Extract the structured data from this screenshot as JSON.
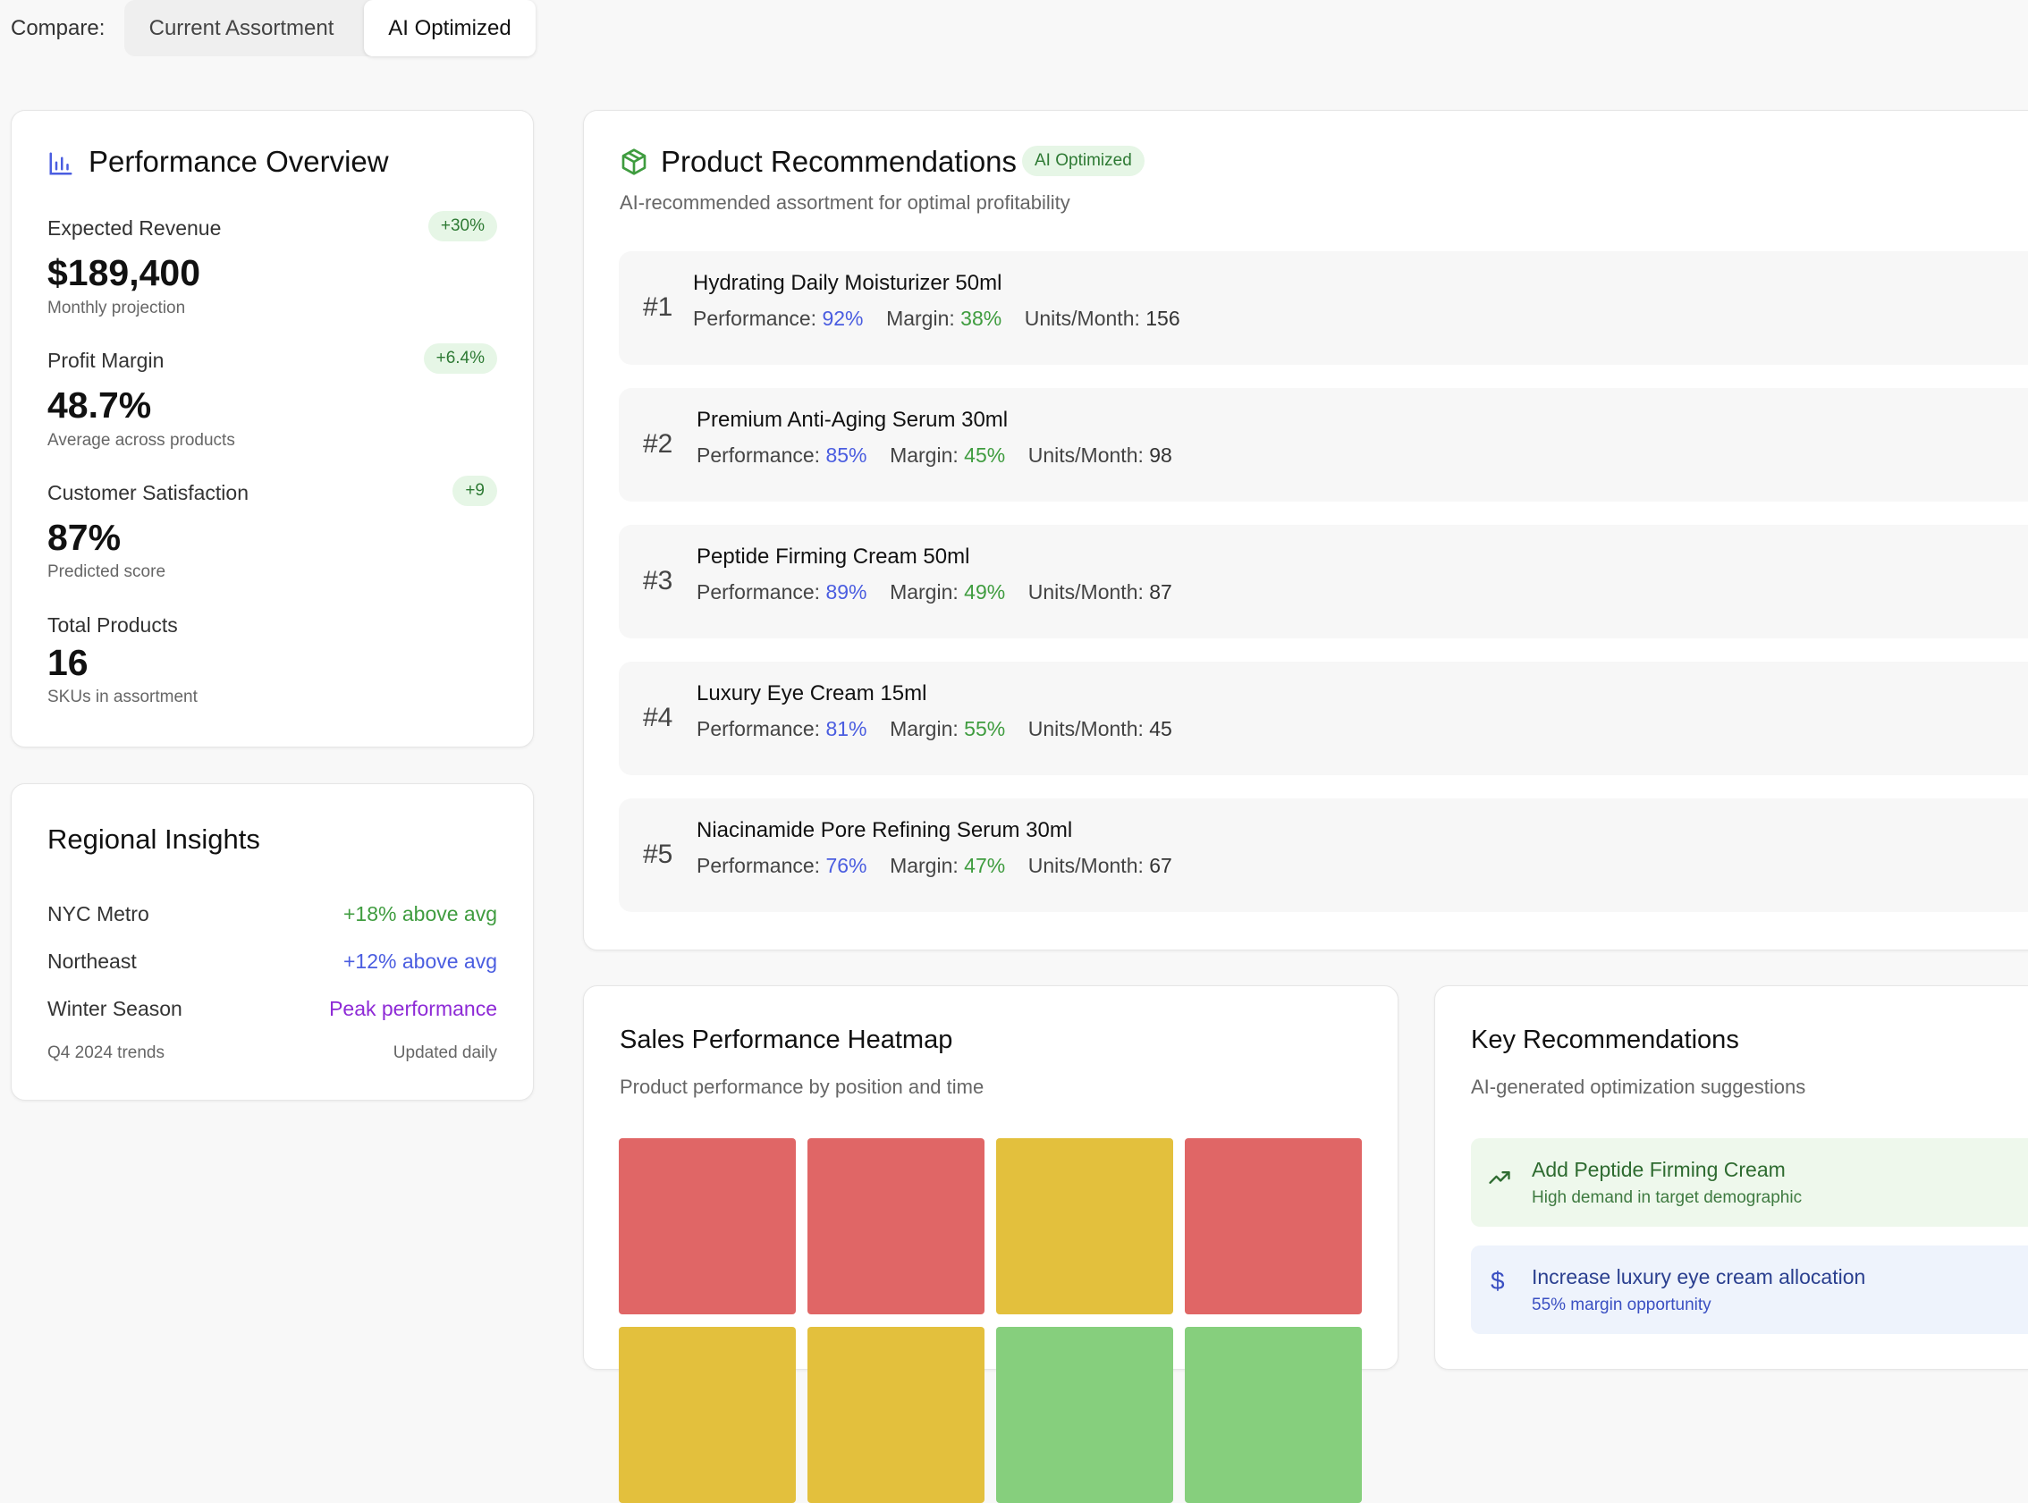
{
  "compare": {
    "label": "Compare:",
    "options": [
      "Current Assortment",
      "AI Optimized"
    ],
    "active": "AI Optimized"
  },
  "performance": {
    "title": "Performance Overview",
    "metrics": [
      {
        "label": "Expected Revenue",
        "value": "$189,400",
        "sub": "Monthly projection",
        "badge": "+30%"
      },
      {
        "label": "Profit Margin",
        "value": "48.7%",
        "sub": "Average across products",
        "badge": "+6.4%"
      },
      {
        "label": "Customer Satisfaction",
        "value": "87%",
        "sub": "Predicted score",
        "badge": "+9"
      },
      {
        "label": "Total Products",
        "value": "16",
        "sub": "SKUs in assortment"
      }
    ]
  },
  "regional": {
    "title": "Regional Insights",
    "rows": [
      {
        "label": "NYC Metro",
        "value": "+18% above avg",
        "color": "#3f9c3f"
      },
      {
        "label": "Northeast",
        "value": "+12% above avg",
        "color": "#4a5de0"
      },
      {
        "label": "Winter Season",
        "value": "Peak performance",
        "color": "#8e2ad6"
      }
    ],
    "footer_left": "Q4 2024 trends",
    "footer_right": "Updated daily"
  },
  "recommendations": {
    "title": "Product Recommendations",
    "badge": "AI Optimized",
    "subtitle": "AI-recommended assortment for optimal profitability",
    "perf_label": "Performance:",
    "margin_label": "Margin:",
    "units_label": "Units/Month:",
    "items": [
      {
        "rank": "#1",
        "name": "Hydrating Daily Moisturizer 50ml",
        "performance": "92%",
        "margin": "38%",
        "units": "156"
      },
      {
        "rank": "#2",
        "name": "Premium Anti-Aging Serum 30ml",
        "performance": "85%",
        "margin": "45%",
        "units": "98"
      },
      {
        "rank": "#3",
        "name": "Peptide Firming Cream 50ml",
        "performance": "89%",
        "margin": "49%",
        "units": "87"
      },
      {
        "rank": "#4",
        "name": "Luxury Eye Cream 15ml",
        "performance": "81%",
        "margin": "55%",
        "units": "45"
      },
      {
        "rank": "#5",
        "name": "Niacinamide Pore Refining Serum 30ml",
        "performance": "76%",
        "margin": "47%",
        "units": "67"
      }
    ]
  },
  "heatmap": {
    "title": "Sales Performance Heatmap",
    "subtitle": "Product performance by position and time",
    "colors": {
      "red": "#e06666",
      "yellow": "#e3c03d",
      "green": "#86cf7d"
    },
    "cells": [
      "red",
      "red",
      "yellow",
      "red",
      "yellow",
      "yellow",
      "green",
      "green"
    ]
  },
  "key_recs": {
    "title": "Key Recommendations",
    "subtitle": "AI-generated optimization suggestions",
    "items": [
      {
        "icon": "trending-up-icon",
        "title": "Add Peptide Firming Cream",
        "sub": "High demand in target demographic",
        "bg": "#eef8ec",
        "color": "#2e6b30"
      },
      {
        "icon": "dollar-icon",
        "title": "Increase luxury eye cream allocation",
        "sub": "55% margin opportunity",
        "bg": "#eef3fc",
        "color": "#2a3f8f"
      }
    ]
  }
}
